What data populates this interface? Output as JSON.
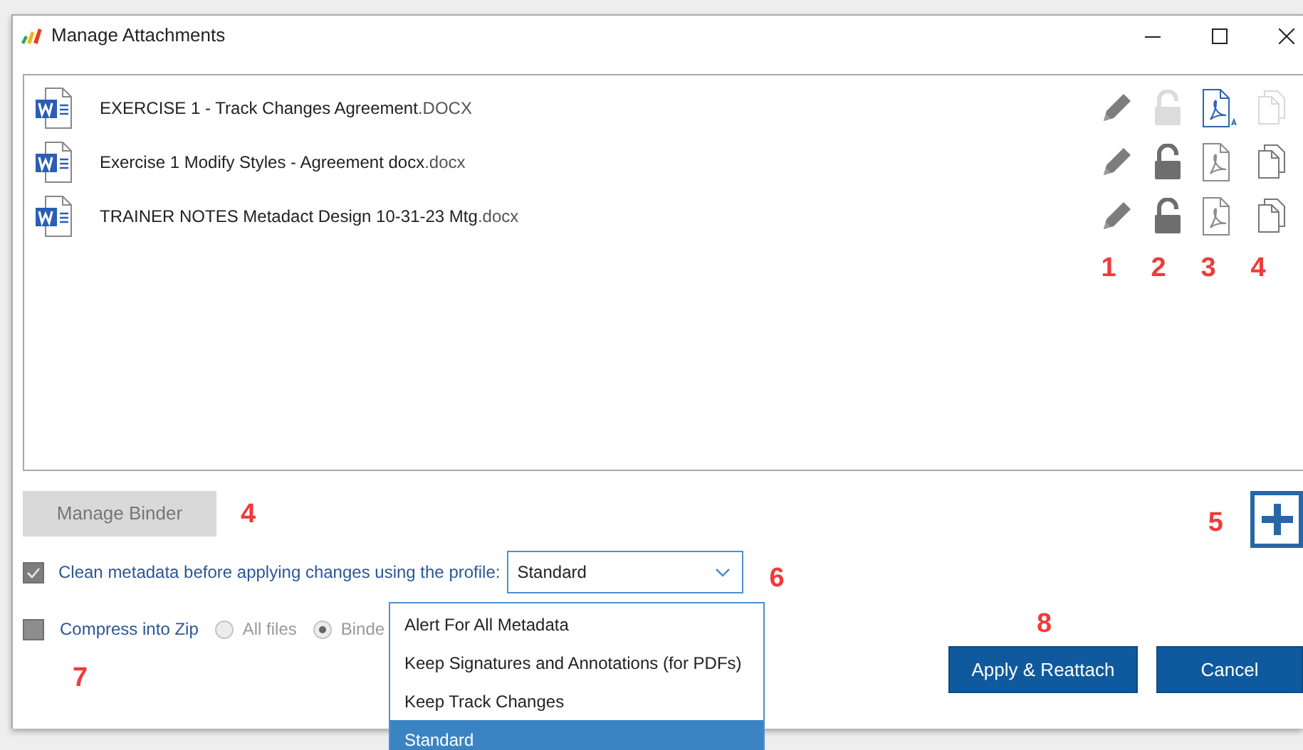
{
  "window": {
    "title": "Manage Attachments"
  },
  "attachments": [
    {
      "name": "EXERCISE 1 - Track Changes Agreement",
      "ext": ".DOCX",
      "lock_enabled": false,
      "pdf_highlighted": true,
      "copy_enabled": false
    },
    {
      "name": "Exercise 1 Modify Styles - Agreement docx",
      "ext": ".docx",
      "lock_enabled": true,
      "pdf_highlighted": false,
      "copy_enabled": true
    },
    {
      "name": "TRAINER NOTES Metadact Design 10-31-23 Mtg",
      "ext": ".docx",
      "lock_enabled": true,
      "pdf_highlighted": false,
      "copy_enabled": true
    }
  ],
  "icon_column_callouts": [
    "1",
    "2",
    "3",
    "4"
  ],
  "manage_binder": {
    "label": "Manage Binder",
    "disabled": true
  },
  "binder_callout": "4",
  "add_callout": "5",
  "clean_metadata": {
    "label": "Clean metadata before applying changes using the profile:",
    "checked": true
  },
  "profile_dropdown": {
    "value": "Standard",
    "options": [
      {
        "label": "Alert For All Metadata",
        "selected": false
      },
      {
        "label": "Keep Signatures and Annotations (for PDFs)",
        "selected": false
      },
      {
        "label": "Keep Track Changes",
        "selected": false
      },
      {
        "label": "Standard",
        "selected": true
      }
    ]
  },
  "profile_callout": "6",
  "compress_zip": {
    "label": "Compress into Zip",
    "checked": false
  },
  "zip_options": [
    {
      "label": "All files",
      "selected": false
    },
    {
      "label": "Binde",
      "selected": true
    }
  ],
  "zip_callout": "7",
  "apply_callout": "8",
  "buttons": [
    "Apply & Reattach",
    "Cancel"
  ]
}
